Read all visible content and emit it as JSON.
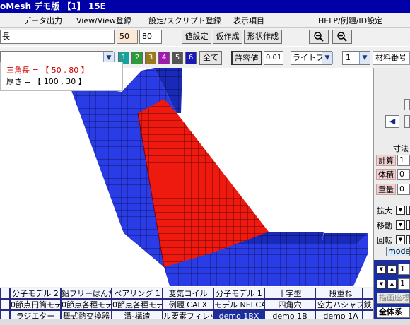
{
  "window": {
    "title": "oMesh  デモ版 【1】   15E"
  },
  "menu": {
    "items": [
      "データ出力",
      "View/View登録",
      "設定/スクリプト登録",
      "表示項目",
      "HELP/例題/ID設定"
    ]
  },
  "toolbar1": {
    "field_value": "長",
    "num1": "50",
    "num2": "80",
    "buttons": [
      "値設定",
      "仮作成",
      "形状作成"
    ],
    "zoom_out": "−",
    "zoom_in": "+"
  },
  "toolbar2": {
    "colors": [
      {
        "label": "1",
        "color": "#1aa19a"
      },
      {
        "label": "2",
        "color": "#2f9a3a"
      },
      {
        "label": "3",
        "color": "#9a7a1a"
      },
      {
        "label": "4",
        "color": "#a01ab0"
      },
      {
        "label": "5",
        "color": "#555555"
      },
      {
        "label": "6",
        "color": "#1a1ab8"
      }
    ],
    "all_label": "全て",
    "tolerance_label": "許容値",
    "tolerance_value": "0.01",
    "light_label": "ライトブ",
    "material_index": "1",
    "material_label": "材料番号"
  },
  "info": {
    "line1": "三角長  = 【 50 , 80 】",
    "line2": "厚さ  = 【 100 , 30 】"
  },
  "right_panel": {
    "dim_title": "寸法",
    "calc_label": "計算",
    "calc_value": "1",
    "volume_label": "体積",
    "volume_value": "0",
    "weight_label": "重量",
    "weight_value": "0",
    "zoom_label": "拡大",
    "move_label": "移動",
    "rotate_label": "回転",
    "mode_label": "mode",
    "spin1": "1",
    "spin2": "1",
    "coord_label": "描画座標",
    "total_label": "全体系"
  },
  "tabs_row1": [
    "分子モデル 2",
    "鉛フリーはんだ",
    "ベアリング 1",
    "変気コイル",
    "分子モデル 1",
    "十字型",
    "段重ね",
    ""
  ],
  "tabs_row2": [
    "0節点円筒モデ",
    "0節点各種モデ",
    "0節点各種モデ",
    "例題 CALX",
    "モデル NEI CA",
    "四角穴",
    "空力ハシャフ",
    "鉄"
  ],
  "tabs_row3": [
    "ラジエター",
    "舞式熱交換器",
    "溝-構造",
    "ル要素フィレッ",
    "demo 1BX",
    "demo 1B",
    "demo 1A",
    ""
  ]
}
